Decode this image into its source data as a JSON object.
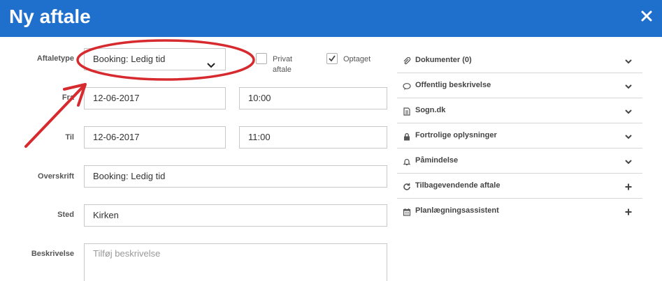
{
  "header": {
    "title": "Ny aftale"
  },
  "form": {
    "type_label": "Aftaletype",
    "type_value": "Booking: Ledig tid",
    "private_label": "Privat aftale",
    "busy_label": "Optaget",
    "from_label": "Fra",
    "from_date": "12-06-2017",
    "from_time": "10:00",
    "to_label": "Til",
    "to_date": "12-06-2017",
    "to_time": "11:00",
    "heading_label": "Overskrift",
    "heading_value": "Booking: Ledig tid",
    "place_label": "Sted",
    "place_value": "Kirken",
    "desc_label": "Beskrivelse",
    "desc_placeholder": "Tilføj beskrivelse"
  },
  "sidebar": {
    "items": [
      {
        "label": "Dokumenter (0)",
        "icon": "paperclip-icon",
        "action": "chevron-down-icon"
      },
      {
        "label": "Offentlig beskrivelse",
        "icon": "comment-icon",
        "action": "chevron-down-icon"
      },
      {
        "label": "Sogn.dk",
        "icon": "document-icon",
        "action": "chevron-down-icon"
      },
      {
        "label": "Fortrolige oplysninger",
        "icon": "lock-icon",
        "action": "chevron-down-icon"
      },
      {
        "label": "Påmindelse",
        "icon": "bell-icon",
        "action": "chevron-down-icon"
      },
      {
        "label": "Tilbagevendende aftale",
        "icon": "refresh-icon",
        "action": "plus-icon"
      },
      {
        "label": "Planlægningsassistent",
        "icon": "calendar-icon",
        "action": "plus-icon"
      }
    ]
  },
  "colors": {
    "header": "#1f6fcc",
    "annotation": "#d62a2f"
  }
}
